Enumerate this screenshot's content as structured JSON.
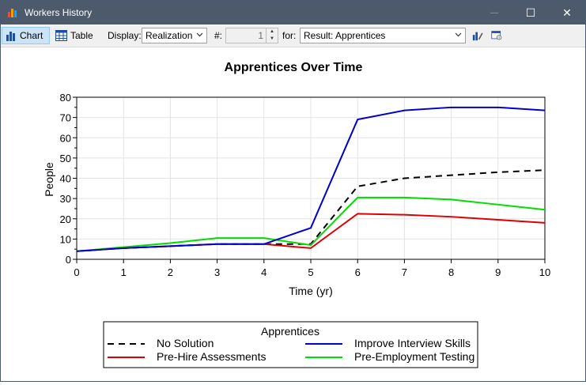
{
  "window": {
    "title": "Workers History",
    "minimize_glyph": "—",
    "maximize_glyph": "☐",
    "close_glyph": "✕"
  },
  "toolbar": {
    "chart_label": "Chart",
    "table_label": "Table",
    "display_label": "Display:",
    "display_value": "Realization",
    "number_label": "#:",
    "number_value": "1",
    "for_label": "for:",
    "for_value": "Result: Apprentices",
    "icons": [
      "chart-icon",
      "table-icon",
      "chart-settings-icon",
      "export-icon"
    ]
  },
  "colors": {
    "accent": "#4d5a6b",
    "no_solution": "#000000",
    "improve_interview": "#0000cc",
    "pre_hire": "#dd0000",
    "pre_employment": "#00dd00"
  },
  "chart_data": {
    "type": "line",
    "title": "Apprentices Over Time",
    "xlabel": "Time (yr)",
    "ylabel": "People",
    "xlim": [
      0,
      10
    ],
    "ylim": [
      0,
      80
    ],
    "x_ticks": [
      "0",
      "1",
      "2",
      "3",
      "4",
      "5",
      "6",
      "7",
      "8",
      "9",
      "10"
    ],
    "y_ticks": [
      "0",
      "10",
      "20",
      "30",
      "40",
      "50",
      "60",
      "70",
      "80"
    ],
    "grid": true,
    "legend_title": "Apprentices",
    "legend_position": "bottom",
    "x": [
      0,
      1,
      2,
      3,
      4,
      5,
      6,
      7,
      8,
      9,
      10
    ],
    "series": [
      {
        "name": "No Solution",
        "color": "#000000",
        "dash": true,
        "values": [
          4,
          5.5,
          6.5,
          7.5,
          7.5,
          7.5,
          36,
          40,
          41.5,
          43,
          44
        ]
      },
      {
        "name": "Improve Interview Skills",
        "color": "#0000cc",
        "dash": false,
        "values": [
          4,
          5.5,
          6.5,
          7.5,
          7.5,
          15.5,
          69,
          73.5,
          75,
          75,
          73.5
        ]
      },
      {
        "name": "Pre-Hire Assessments",
        "color": "#dd0000",
        "dash": false,
        "values": [
          4,
          5.5,
          6.5,
          7.5,
          7.5,
          5.5,
          22.5,
          22,
          21,
          19.5,
          18
        ]
      },
      {
        "name": "Pre-Employment Testing",
        "color": "#00dd00",
        "dash": false,
        "values": [
          4,
          6,
          8,
          10.5,
          10.5,
          7,
          30.5,
          30.5,
          29.5,
          27,
          24.5
        ]
      }
    ]
  }
}
